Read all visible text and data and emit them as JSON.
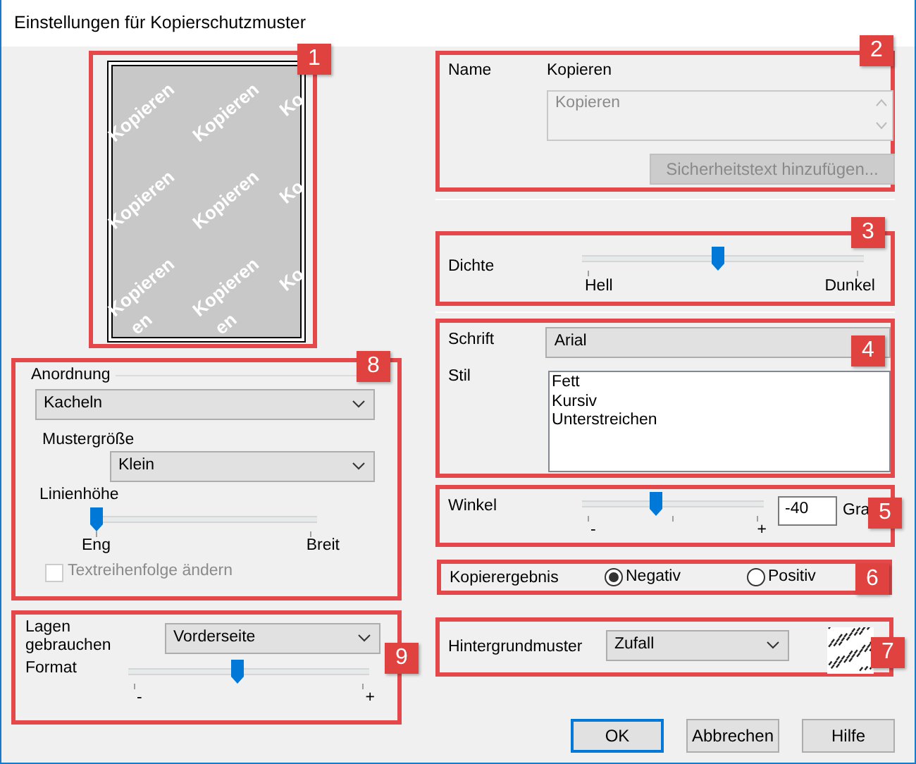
{
  "window": {
    "title": "Einstellungen für Kopierschutzmuster"
  },
  "preview": {
    "callout": "1",
    "tile_rows": [
      [
        "Kopieren",
        "Kopieren",
        "Ko"
      ],
      [
        "Kopieren",
        "Kopieren",
        "Ko"
      ],
      [
        "Kopieren",
        "Kopieren",
        "Ko"
      ],
      [
        "en",
        "en"
      ]
    ]
  },
  "security_text": {
    "callout": "2",
    "name_label": "Name",
    "name_value": "Kopieren",
    "text_field": "Kopieren",
    "add_button": {
      "label": "Sicherheitstext hinzufügen...",
      "disabled": true
    }
  },
  "density": {
    "callout": "3",
    "label": "Dichte",
    "level": 0.48,
    "min_label": "Hell",
    "max_label": "Dunkel"
  },
  "font": {
    "callout": "4",
    "font_label": "Schrift",
    "font_value": "Arial",
    "style_label": "Stil",
    "styles": [
      "Fett",
      "Kursiv",
      "Unterstreichen"
    ]
  },
  "angle": {
    "callout": "5",
    "label": "Winkel",
    "level": 0.4,
    "min_label": "-",
    "max_label": "+",
    "value": "-40",
    "unit": "Gra"
  },
  "copy_result": {
    "callout": "6",
    "label": "Kopierergebnis",
    "options": [
      {
        "label": "Negativ",
        "selected": true
      },
      {
        "label": "Positiv",
        "selected": false
      }
    ]
  },
  "background_pattern": {
    "callout": "7",
    "label": "Hintergrundmuster",
    "value": "Zufall"
  },
  "arrangement": {
    "callout": "8",
    "label": "Anordnung",
    "value": "Kacheln",
    "size_label": "Mustergröße",
    "size_value": "Klein",
    "line_height_label": "Linienhöhe",
    "level": 0.0,
    "min_label": "Eng",
    "max_label": "Breit",
    "reverse_order": {
      "label": "Textreihenfolge ändern",
      "checked": false,
      "disabled": true
    }
  },
  "layers": {
    "callout": "9",
    "label": "Lagen gebrauchen",
    "value": "Vorderseite",
    "format_label": "Format",
    "level": 0.45,
    "min_label": "-",
    "max_label": "+"
  },
  "buttons": [
    {
      "label": "OK",
      "default": true
    },
    {
      "label": "Abbrechen",
      "default": false
    },
    {
      "label": "Hilfe",
      "default": false
    }
  ]
}
